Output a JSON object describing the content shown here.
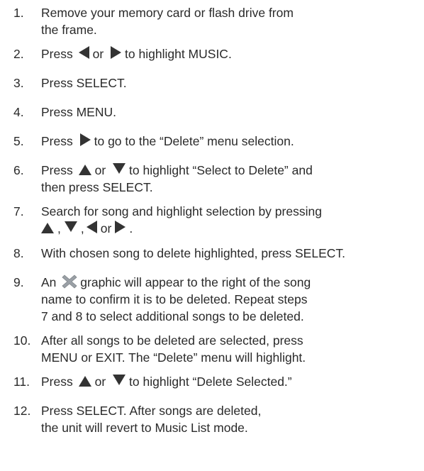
{
  "steps": [
    {
      "num": "1.",
      "lines": [
        "Remove your memory card or flash drive from",
        "the frame."
      ]
    },
    {
      "num": "2.",
      "t1": "Press",
      "t2": "or",
      "t3": "to highlight MUSIC."
    },
    {
      "num": "3.",
      "text": "Press SELECT."
    },
    {
      "num": "4.",
      "text": "Press MENU."
    },
    {
      "num": "5.",
      "t1": "Press",
      "t2": "to go to the “Delete” menu selection."
    },
    {
      "num": "6.",
      "t1": "Press",
      "t2": "or",
      "t3": "to highlight “Select to Delete” and",
      "line2": "then press SELECT."
    },
    {
      "num": "7.",
      "line1": "Search for song and highlight selection by pressing",
      "sep1": ",",
      "sep2": ",",
      "sep3": "or",
      "end": "."
    },
    {
      "num": "8.",
      "text": "With chosen song to delete highlighted, press SELECT."
    },
    {
      "num": "9.",
      "t1": "An",
      "t2": "graphic will appear to the right of the song",
      "line2": "name to confirm it is to be deleted. Repeat steps",
      "line3": "7 and 8 to select additional songs to be deleted."
    },
    {
      "num": "10.",
      "lines": [
        "After all songs to be deleted are selected, press",
        "MENU or EXIT. The “Delete” menu will highlight."
      ]
    },
    {
      "num": "11.",
      "t1": "Press",
      "t2": "or",
      "t3": "to highlight “Delete Selected.”"
    },
    {
      "num": "12.",
      "lines": [
        "Press SELECT. After songs are deleted,",
        "the unit will revert to Music List mode."
      ]
    }
  ],
  "icons": {
    "left": "left-arrow-icon",
    "right": "right-arrow-icon",
    "up": "up-arrow-icon",
    "down": "down-arrow-icon",
    "delete_mark": "delete-x-icon"
  },
  "colors": {
    "text": "#2a2a2a",
    "delete_mark": "#9aa0a6"
  }
}
